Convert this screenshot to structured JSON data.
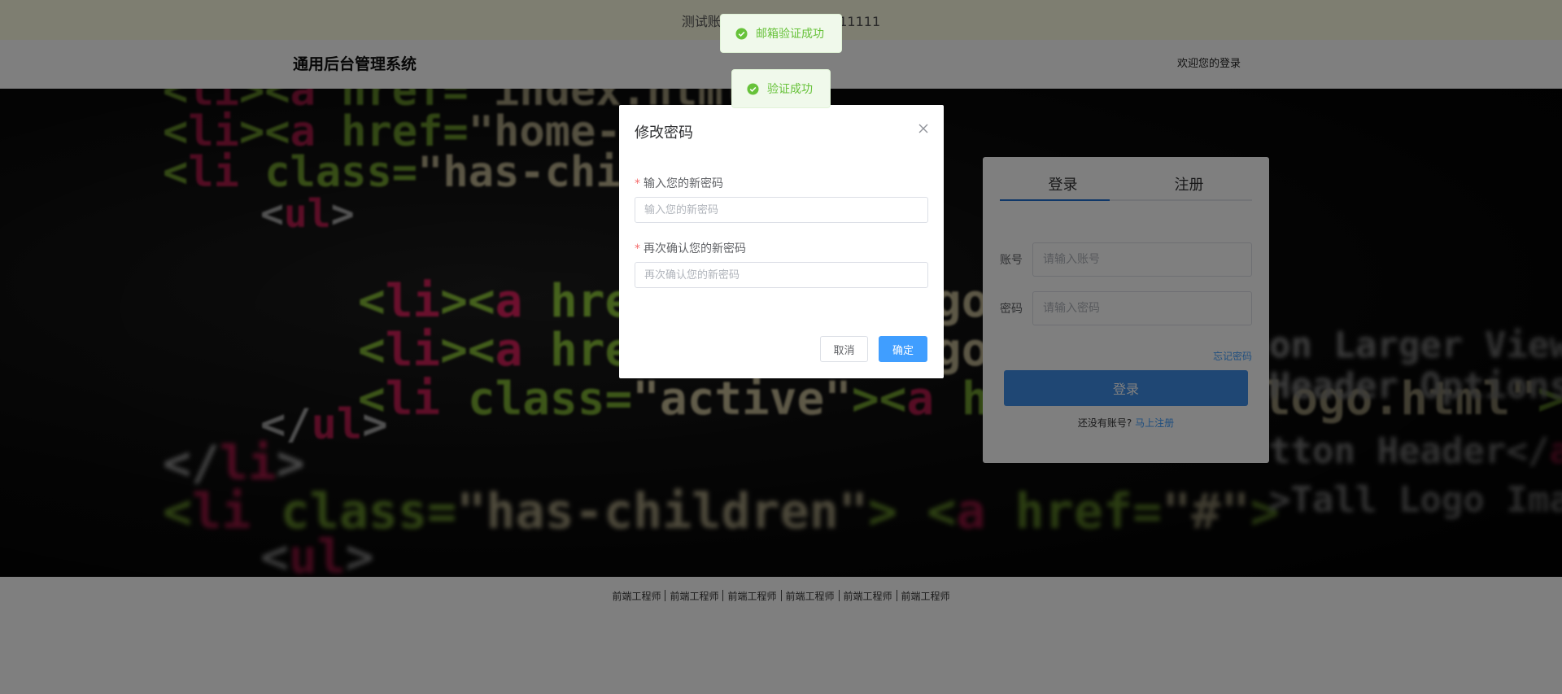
{
  "notice": {
    "text": "测试账号：admin 密码：111111"
  },
  "header": {
    "brand": "通用后台管理系统",
    "welcome": "欢迎您的登录"
  },
  "login": {
    "tabs": [
      {
        "label": "登录",
        "active": true
      },
      {
        "label": "注册",
        "active": false
      }
    ],
    "account_label": "账号",
    "account_placeholder": "请输入账号",
    "password_label": "密码",
    "password_placeholder": "请输入密码",
    "forgot": "忘记密码",
    "submit": "登录",
    "no_account": "还没有账号?",
    "register_link": "马上注册"
  },
  "footer": {
    "links": [
      "前端工程师",
      "前端工程师",
      "前端工程师",
      "前端工程师",
      "前端工程师",
      "前端工程师"
    ]
  },
  "dialog": {
    "title": "修改密码",
    "new_password_label": "输入您的新密码",
    "new_password_placeholder": "输入您的新密码",
    "confirm_label": "再次确认您的新密码",
    "confirm_placeholder": "再次确认您的新密码",
    "cancel": "取消",
    "confirm": "确定"
  },
  "toasts": [
    {
      "text": "邮箱验证成功",
      "type": "success"
    },
    {
      "text": "验证成功",
      "type": "success"
    }
  ],
  "colors": {
    "primary": "#409eff",
    "login_button": "#3f8fe8",
    "success": "#67c23a",
    "required": "#f56c6c"
  },
  "icons": [
    "close-icon",
    "success-check-icon"
  ]
}
